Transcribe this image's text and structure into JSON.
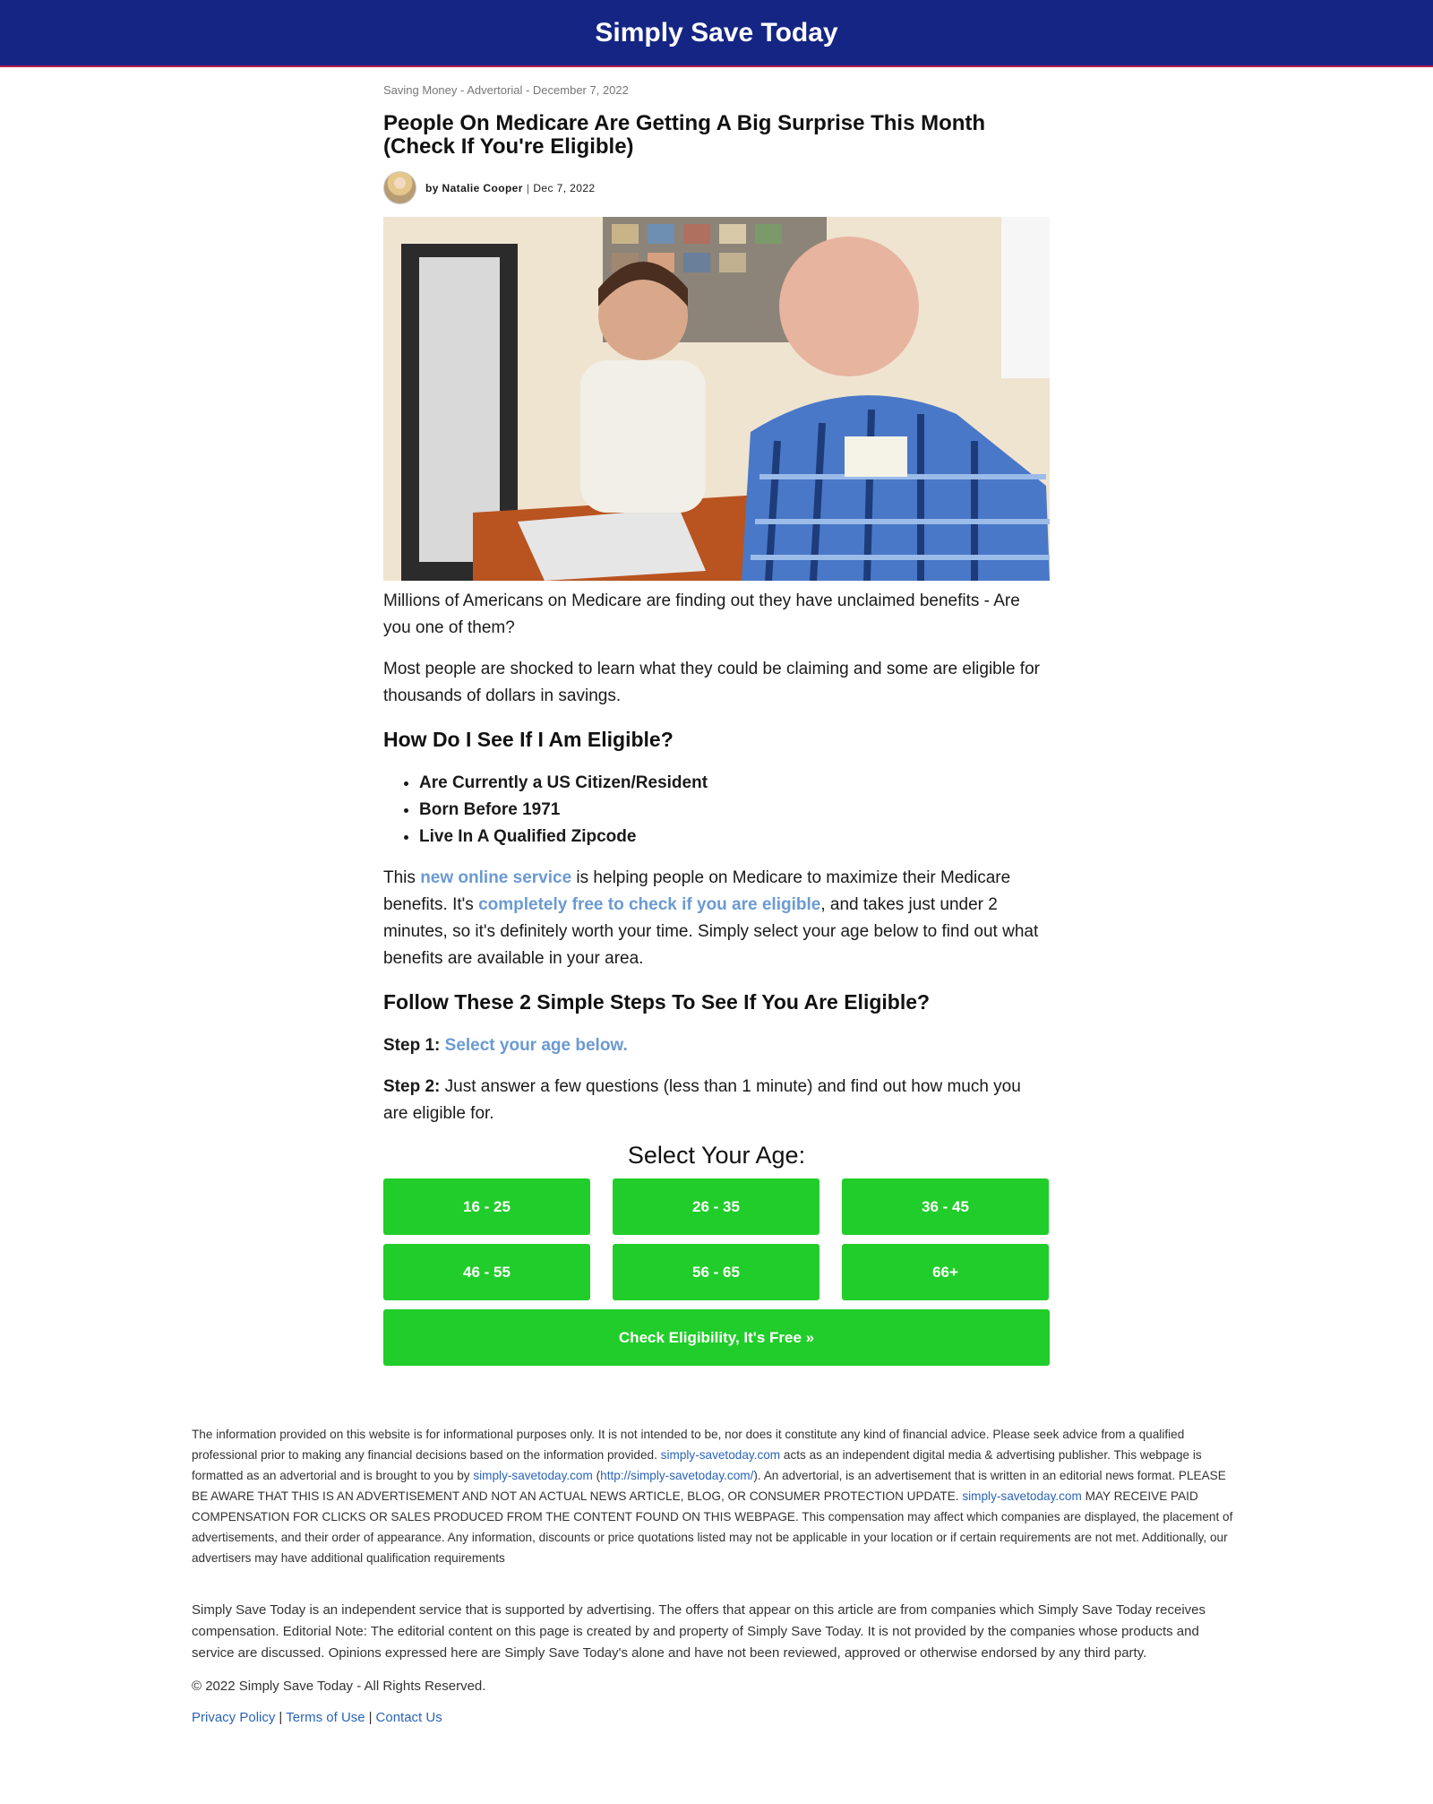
{
  "header": {
    "site_title": "Simply Save Today"
  },
  "article": {
    "meta": "Saving Money - Advertorial - December 7, 2022",
    "headline_line1": "People On Medicare Are Getting A Big Surprise This Month",
    "headline_line2": "(Check If You're Eligible)",
    "author": "by Natalie Cooper",
    "byline_separator": "|",
    "date": "Dec 7, 2022",
    "intro_1": "Millions of Americans on Medicare are finding out they have unclaimed benefits - Are you one of them?",
    "intro_2": "Most people are shocked to learn what they could be claiming and some are eligible for thousands of dollars in savings.",
    "eligibility_heading": "How Do I See If I Am Eligible?",
    "requirements": [
      "Are Currently a US Citizen/Resident",
      "Born Before 1971",
      "Live In A Qualified Zipcode"
    ],
    "service_para": {
      "part1": "This ",
      "link1": "new online service",
      "part2": " is helping people on Medicare to maximize their Medicare benefits. It's ",
      "link2": "completely free to check if you are eligible",
      "part3": ", and takes just under 2 minutes, so it's definitely worth your time. Simply select your age below to find out what benefits are available in your area."
    },
    "steps_heading": "Follow These 2 Simple Steps To See If You Are Eligible?",
    "step1_label": "Step 1:",
    "step1_link": "Select your age below.",
    "step2_label": "Step 2:",
    "step2_text": " Just answer a few questions (less than 1 minute) and find out how much you are eligible for."
  },
  "age_selector": {
    "title": "Select Your Age:",
    "options": [
      "16 - 25",
      "26 - 35",
      "36 - 45",
      "46 - 55",
      "56 - 65",
      "66+"
    ],
    "cta_label": "Check Eligibility, It's Free »"
  },
  "footer": {
    "disclaimer": {
      "p1": "The information provided on this website is for informational purposes only. It is not intended to be, nor does it constitute any kind of financial advice. Please seek advice from a qualified professional prior to making any financial decisions based on the information provided. ",
      "domain": "simply-savetoday.com",
      "p2": " acts as an independent digital media & advertising publisher. This webpage is formatted as an advertorial and is brought to you by ",
      "p3": " (",
      "url": "http://simply-savetoday.com/",
      "p4": "). An advertorial, is an advertisement that is written in an editorial news format. PLEASE BE AWARE THAT THIS IS AN ADVERTISEMENT AND NOT AN ACTUAL NEWS ARTICLE, BLOG, OR CONSUMER PROTECTION UPDATE. ",
      "p5": " MAY RECEIVE PAID COMPENSATION FOR CLICKS OR SALES PRODUCED FROM THE CONTENT FOUND ON THIS WEBPAGE. This compensation may affect which companies are displayed, the placement of advertisements, and their order of appearance. Any information, discounts or price quotations listed may not be applicable in your location or if certain requirements are not met. Additionally, our advertisers may have additional qualification requirements"
    },
    "editorial_note": "Simply Save Today is an independent service that is supported by advertising. The offers that appear on this article are from companies which Simply Save Today receives compensation. Editorial Note: The editorial content on this page is created by and property of Simply Save Today. It is not provided by the companies whose products and service are discussed. Opinions expressed here are Simply Save Today's alone and have not been reviewed, approved or otherwise endorsed by any third party.",
    "copyright": "© 2022 Simply Save Today - All Rights Reserved.",
    "links": [
      "Privacy Policy",
      "Terms of Use",
      "Contact Us"
    ],
    "link_separator": "|"
  }
}
